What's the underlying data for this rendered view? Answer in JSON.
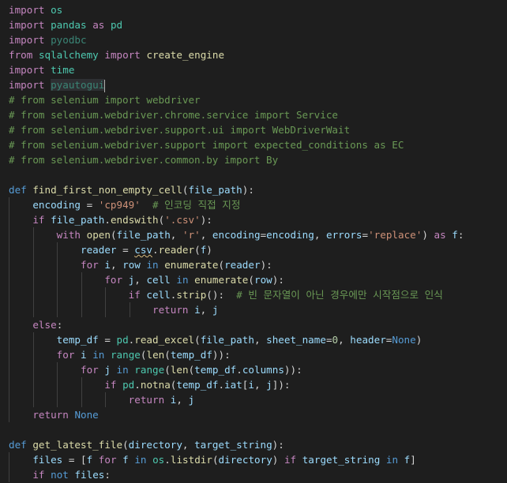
{
  "editor": {
    "language": "python",
    "lines": [
      {
        "indent": 0,
        "tokens": [
          [
            "kw",
            "import"
          ],
          [
            "txt",
            " "
          ],
          [
            "mod",
            "os"
          ]
        ]
      },
      {
        "indent": 0,
        "tokens": [
          [
            "kw",
            "import"
          ],
          [
            "txt",
            " "
          ],
          [
            "mod",
            "pandas"
          ],
          [
            "txt",
            " "
          ],
          [
            "kw",
            "as"
          ],
          [
            "txt",
            " "
          ],
          [
            "mod",
            "pd"
          ]
        ]
      },
      {
        "indent": 0,
        "tokens": [
          [
            "kw",
            "import"
          ],
          [
            "txt",
            " "
          ],
          [
            "dim",
            "pyodbc"
          ]
        ]
      },
      {
        "indent": 0,
        "tokens": [
          [
            "kw",
            "from"
          ],
          [
            "txt",
            " "
          ],
          [
            "mod",
            "sqlalchemy"
          ],
          [
            "txt",
            " "
          ],
          [
            "kw",
            "import"
          ],
          [
            "txt",
            " "
          ],
          [
            "fn",
            "create_engine"
          ]
        ]
      },
      {
        "indent": 0,
        "tokens": [
          [
            "kw",
            "import"
          ],
          [
            "txt",
            " "
          ],
          [
            "mod",
            "time"
          ]
        ]
      },
      {
        "indent": 0,
        "tokens": [
          [
            "kw",
            "import"
          ],
          [
            "txt",
            " "
          ],
          [
            "hl",
            "pyautogui"
          ]
        ],
        "cursor": true
      },
      {
        "indent": 0,
        "tokens": [
          [
            "cmt",
            "# from selenium import webdriver"
          ]
        ]
      },
      {
        "indent": 0,
        "tokens": [
          [
            "cmt",
            "# from selenium.webdriver.chrome.service import Service"
          ]
        ]
      },
      {
        "indent": 0,
        "tokens": [
          [
            "cmt",
            "# from selenium.webdriver.support.ui import WebDriverWait"
          ]
        ]
      },
      {
        "indent": 0,
        "tokens": [
          [
            "cmt",
            "# from selenium.webdriver.support import expected_conditions as EC"
          ]
        ]
      },
      {
        "indent": 0,
        "tokens": [
          [
            "cmt",
            "# from selenium.webdriver.common.by import By"
          ]
        ]
      },
      {
        "indent": 0,
        "tokens": []
      },
      {
        "indent": 0,
        "tokens": [
          [
            "def",
            "def"
          ],
          [
            "txt",
            " "
          ],
          [
            "fn",
            "find_first_non_empty_cell"
          ],
          [
            "txt",
            "("
          ],
          [
            "var",
            "file_path"
          ],
          [
            "txt",
            "):"
          ]
        ]
      },
      {
        "indent": 1,
        "tokens": [
          [
            "var",
            "encoding"
          ],
          [
            "txt",
            " = "
          ],
          [
            "str",
            "'cp949'"
          ],
          [
            "txt",
            "  "
          ],
          [
            "cmt",
            "# 인코딩 직접 지정"
          ]
        ]
      },
      {
        "indent": 1,
        "tokens": [
          [
            "kw",
            "if"
          ],
          [
            "txt",
            " "
          ],
          [
            "var",
            "file_path"
          ],
          [
            "txt",
            "."
          ],
          [
            "fn",
            "endswith"
          ],
          [
            "txt",
            "("
          ],
          [
            "str",
            "'.csv'"
          ],
          [
            "txt",
            "):"
          ]
        ]
      },
      {
        "indent": 2,
        "tokens": [
          [
            "kw",
            "with"
          ],
          [
            "txt",
            " "
          ],
          [
            "fn",
            "open"
          ],
          [
            "txt",
            "("
          ],
          [
            "var",
            "file_path"
          ],
          [
            "txt",
            ", "
          ],
          [
            "str",
            "'r'"
          ],
          [
            "txt",
            ", "
          ],
          [
            "var",
            "encoding"
          ],
          [
            "txt",
            "="
          ],
          [
            "var",
            "encoding"
          ],
          [
            "txt",
            ", "
          ],
          [
            "var",
            "errors"
          ],
          [
            "txt",
            "="
          ],
          [
            "str",
            "'replace'"
          ],
          [
            "txt",
            ") "
          ],
          [
            "kw",
            "as"
          ],
          [
            "txt",
            " "
          ],
          [
            "var",
            "f"
          ],
          [
            "txt",
            ":"
          ]
        ]
      },
      {
        "indent": 3,
        "tokens": [
          [
            "var",
            "reader"
          ],
          [
            "txt",
            " = "
          ],
          [
            "warn",
            "csv"
          ],
          [
            "txt",
            "."
          ],
          [
            "fn",
            "reader"
          ],
          [
            "txt",
            "("
          ],
          [
            "var",
            "f"
          ],
          [
            "txt",
            ")"
          ]
        ]
      },
      {
        "indent": 3,
        "tokens": [
          [
            "kw",
            "for"
          ],
          [
            "txt",
            " "
          ],
          [
            "var",
            "i"
          ],
          [
            "txt",
            ", "
          ],
          [
            "var",
            "row"
          ],
          [
            "txt",
            " "
          ],
          [
            "def",
            "in"
          ],
          [
            "txt",
            " "
          ],
          [
            "fn",
            "enumerate"
          ],
          [
            "txt",
            "("
          ],
          [
            "var",
            "reader"
          ],
          [
            "txt",
            "):"
          ]
        ]
      },
      {
        "indent": 4,
        "tokens": [
          [
            "kw",
            "for"
          ],
          [
            "txt",
            " "
          ],
          [
            "var",
            "j"
          ],
          [
            "txt",
            ", "
          ],
          [
            "var",
            "cell"
          ],
          [
            "txt",
            " "
          ],
          [
            "def",
            "in"
          ],
          [
            "txt",
            " "
          ],
          [
            "fn",
            "enumerate"
          ],
          [
            "txt",
            "("
          ],
          [
            "var",
            "row"
          ],
          [
            "txt",
            "):"
          ]
        ]
      },
      {
        "indent": 5,
        "tokens": [
          [
            "kw",
            "if"
          ],
          [
            "txt",
            " "
          ],
          [
            "var",
            "cell"
          ],
          [
            "txt",
            "."
          ],
          [
            "fn",
            "strip"
          ],
          [
            "txt",
            "():  "
          ],
          [
            "cmt",
            "# 빈 문자열이 아닌 경우에만 시작점으로 인식"
          ]
        ]
      },
      {
        "indent": 6,
        "tokens": [
          [
            "kw",
            "return"
          ],
          [
            "txt",
            " "
          ],
          [
            "var",
            "i"
          ],
          [
            "txt",
            ", "
          ],
          [
            "var",
            "j"
          ]
        ]
      },
      {
        "indent": 1,
        "tokens": [
          [
            "kw",
            "else"
          ],
          [
            "txt",
            ":"
          ]
        ]
      },
      {
        "indent": 2,
        "tokens": [
          [
            "var",
            "temp_df"
          ],
          [
            "txt",
            " = "
          ],
          [
            "mod",
            "pd"
          ],
          [
            "txt",
            "."
          ],
          [
            "fn",
            "read_excel"
          ],
          [
            "txt",
            "("
          ],
          [
            "var",
            "file_path"
          ],
          [
            "txt",
            ", "
          ],
          [
            "var",
            "sheet_name"
          ],
          [
            "txt",
            "="
          ],
          [
            "num",
            "0"
          ],
          [
            "txt",
            ", "
          ],
          [
            "var",
            "header"
          ],
          [
            "txt",
            "="
          ],
          [
            "def",
            "None"
          ],
          [
            "txt",
            ")"
          ]
        ]
      },
      {
        "indent": 2,
        "tokens": [
          [
            "kw",
            "for"
          ],
          [
            "txt",
            " "
          ],
          [
            "var",
            "i"
          ],
          [
            "txt",
            " "
          ],
          [
            "def",
            "in"
          ],
          [
            "txt",
            " "
          ],
          [
            "mod",
            "range"
          ],
          [
            "txt",
            "("
          ],
          [
            "fn",
            "len"
          ],
          [
            "txt",
            "("
          ],
          [
            "var",
            "temp_df"
          ],
          [
            "txt",
            "))"
          ],
          [
            "txt",
            ":"
          ]
        ]
      },
      {
        "indent": 3,
        "tokens": [
          [
            "kw",
            "for"
          ],
          [
            "txt",
            " "
          ],
          [
            "var",
            "j"
          ],
          [
            "txt",
            " "
          ],
          [
            "def",
            "in"
          ],
          [
            "txt",
            " "
          ],
          [
            "mod",
            "range"
          ],
          [
            "txt",
            "("
          ],
          [
            "fn",
            "len"
          ],
          [
            "txt",
            "("
          ],
          [
            "var",
            "temp_df"
          ],
          [
            "txt",
            "."
          ],
          [
            "var",
            "columns"
          ],
          [
            "txt",
            "))"
          ],
          [
            "txt",
            ":"
          ]
        ]
      },
      {
        "indent": 4,
        "tokens": [
          [
            "kw",
            "if"
          ],
          [
            "txt",
            " "
          ],
          [
            "mod",
            "pd"
          ],
          [
            "txt",
            "."
          ],
          [
            "fn",
            "notna"
          ],
          [
            "txt",
            "("
          ],
          [
            "var",
            "temp_df"
          ],
          [
            "txt",
            "."
          ],
          [
            "var",
            "iat"
          ],
          [
            "txt",
            "["
          ],
          [
            "var",
            "i"
          ],
          [
            "txt",
            ", "
          ],
          [
            "var",
            "j"
          ],
          [
            "txt",
            "]):"
          ]
        ]
      },
      {
        "indent": 5,
        "tokens": [
          [
            "kw",
            "return"
          ],
          [
            "txt",
            " "
          ],
          [
            "var",
            "i"
          ],
          [
            "txt",
            ", "
          ],
          [
            "var",
            "j"
          ]
        ]
      },
      {
        "indent": 1,
        "tokens": [
          [
            "kw",
            "return"
          ],
          [
            "txt",
            " "
          ],
          [
            "def",
            "None"
          ]
        ]
      },
      {
        "indent": 0,
        "tokens": []
      },
      {
        "indent": 0,
        "tokens": [
          [
            "def",
            "def"
          ],
          [
            "txt",
            " "
          ],
          [
            "fn",
            "get_latest_file"
          ],
          [
            "txt",
            "("
          ],
          [
            "var",
            "directory"
          ],
          [
            "txt",
            ", "
          ],
          [
            "var",
            "target_string"
          ],
          [
            "txt",
            "):"
          ]
        ]
      },
      {
        "indent": 1,
        "tokens": [
          [
            "var",
            "files"
          ],
          [
            "txt",
            " = ["
          ],
          [
            "var",
            "f"
          ],
          [
            "txt",
            " "
          ],
          [
            "kw",
            "for"
          ],
          [
            "txt",
            " "
          ],
          [
            "var",
            "f"
          ],
          [
            "txt",
            " "
          ],
          [
            "def",
            "in"
          ],
          [
            "txt",
            " "
          ],
          [
            "mod",
            "os"
          ],
          [
            "txt",
            "."
          ],
          [
            "fn",
            "listdir"
          ],
          [
            "txt",
            "("
          ],
          [
            "var",
            "directory"
          ],
          [
            "txt",
            ") "
          ],
          [
            "kw",
            "if"
          ],
          [
            "txt",
            " "
          ],
          [
            "var",
            "target_string"
          ],
          [
            "txt",
            " "
          ],
          [
            "def",
            "in"
          ],
          [
            "txt",
            " "
          ],
          [
            "var",
            "f"
          ],
          [
            "txt",
            "]"
          ]
        ]
      },
      {
        "indent": 1,
        "tokens": [
          [
            "kw",
            "if"
          ],
          [
            "txt",
            " "
          ],
          [
            "def",
            "not"
          ],
          [
            "txt",
            " "
          ],
          [
            "var",
            "files"
          ],
          [
            "txt",
            ":"
          ]
        ]
      }
    ]
  }
}
